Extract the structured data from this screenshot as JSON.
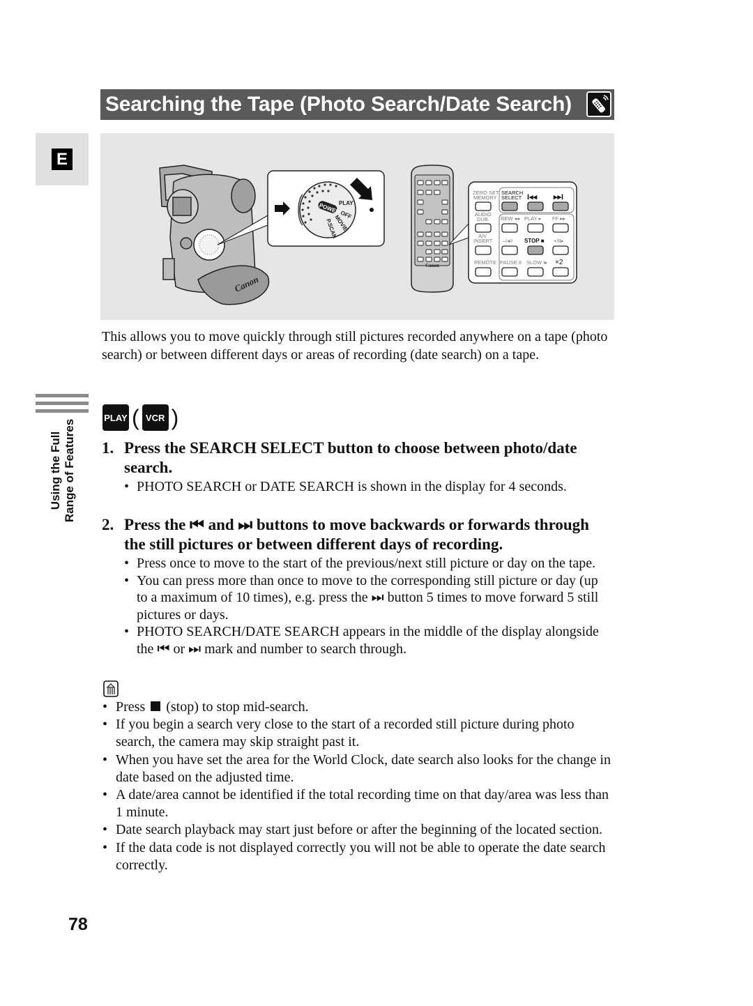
{
  "header": {
    "title": "Searching the Tape (Photo Search/Date Search)",
    "title_icon": "remote-control-icon"
  },
  "side_tab": {
    "language_letter": "E"
  },
  "section_label": {
    "line1": "Using the Full",
    "line2": "Range of Features"
  },
  "illustration": {
    "dial_labels": {
      "power": "POWER",
      "play": "PLAY",
      "off": "OFF",
      "movie": "MOVIE",
      "pscan": "P.SCAN"
    },
    "remote_brand": "Canon",
    "camcorder_brand": "Canon",
    "remote_panel": {
      "row1": [
        "ZERO SET MEMORY",
        "SEARCH SELECT",
        "|◀◀",
        "▶▶|"
      ],
      "row2": [
        "AUDIO DUB.",
        "REW ◀◀",
        "PLAY ▶",
        "FF ▶▶"
      ],
      "row3": [
        "A/V INSERT",
        "–/◀II",
        "STOP ■",
        "+/II▶"
      ],
      "row4": [
        "REMOTE",
        "PAUSE II",
        "SLOW I▶",
        "×2"
      ]
    }
  },
  "intro_text": "This allows you to move quickly through still pictures recorded anywhere on a tape (photo search) or between different days or areas of recording (date search) on a tape.",
  "modes": {
    "primary": "PLAY",
    "secondary": "VCR",
    "open_paren": "(",
    "close_paren": ")"
  },
  "steps": [
    {
      "number": "1.",
      "heading": "Press the SEARCH SELECT button to choose between photo/date search.",
      "bullets": [
        "PHOTO SEARCH or DATE SEARCH is shown in the display for 4 seconds."
      ]
    },
    {
      "number": "2.",
      "heading_parts": {
        "a": "Press the",
        "b": "and",
        "c": "buttons to move backwards or forwards through the still pictures or between different days of recording."
      },
      "bullets": [
        "Press once to move to the start of the previous/next still picture or day on the tape.",
        {
          "a": "You can press more than once to move to the corresponding still picture or day (up to a maximum of 10 times), e.g. press the",
          "b": "button 5 times to move forward 5 still pictures or days."
        },
        {
          "a": "PHOTO SEARCH/DATE SEARCH appears in the middle of the display alongside the",
          "b": "or",
          "c": "mark and number to search through."
        }
      ]
    }
  ],
  "symbols": {
    "skip_back": "⏮",
    "skip_forward": "⏭"
  },
  "notes": {
    "icon": "note-icon",
    "items": [
      {
        "a": "Press",
        "b": "(stop) to stop mid-search."
      },
      "If you begin a search very close to the start of a recorded still picture during photo search, the camera may skip straight past it.",
      "When you have set the area for the World Clock, date search also looks for the change in date based on the adjusted time.",
      "A date/area cannot be identified if the total recording time on that day/area was less than 1 minute.",
      "Date search playback may start just before or after the beginning of the located section.",
      "If the data code is not displayed correctly you will not be able to operate the date search correctly."
    ]
  },
  "page_number": "78",
  "colors": {
    "title_bar": "#5a5a5a",
    "panel_bg": "#e6e6e6",
    "tab_bg": "#e0e0e0",
    "side_bars": "#8a8a8a"
  }
}
